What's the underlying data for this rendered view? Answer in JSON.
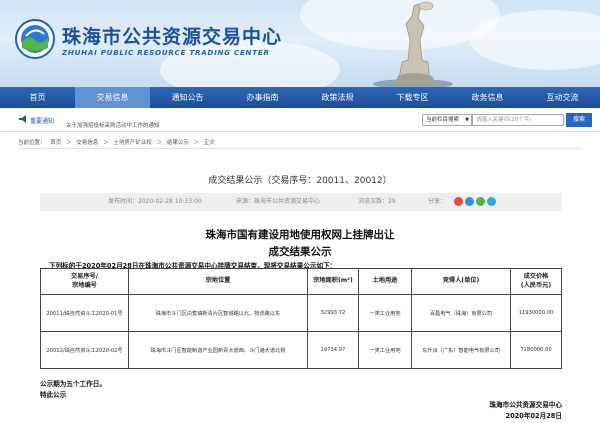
{
  "site": {
    "title": "珠海市公共资源交易中心",
    "subtitle": "ZHUHAI PUBLIC RESOURCE TRADING CENTER"
  },
  "nav": {
    "items": [
      {
        "label": "首页",
        "active": false
      },
      {
        "label": "交易信息",
        "active": true
      },
      {
        "label": "通知公告",
        "active": false
      },
      {
        "label": "办事指南",
        "active": false
      },
      {
        "label": "政策法规",
        "active": false
      },
      {
        "label": "下载专区",
        "active": false
      },
      {
        "label": "政务信息",
        "active": false
      },
      {
        "label": "互动交流",
        "active": false
      }
    ]
  },
  "notice": {
    "label": "重要通知",
    "text": "关于加强招投标采购活动中工作的通知"
  },
  "search": {
    "scope": "当前栏目搜索",
    "placeholder": "请输入关键词(20个字)",
    "button": "搜索"
  },
  "breadcrumb": [
    "当前位置：",
    "首页",
    "＞",
    "交易信息",
    "＞",
    "土地房产矿业权",
    "＞",
    "结果公示",
    "＞",
    "正文"
  ],
  "article": {
    "title": "成交结果公示（交易序号：20011、20012）",
    "meta": {
      "date": "发布时间：2020-02-28 10:33:00",
      "source": "来源：珠海市公共资源交易中心",
      "views": "浏览次数：29",
      "share_label": "分享："
    },
    "heading_line1": "珠海市国有建设用地使用权网上挂牌出让",
    "heading_line2": "成交结果公示",
    "intro": "下列标的于2020年02月28日在珠海市公共资源交易中心挂牌交易结束，现将交易结果公示如下："
  },
  "table": {
    "headers": [
      "交易序号/\n宗地编号",
      "宗地位置",
      "宗地面积(m²)",
      "土地用途",
      "竞得人(单位)",
      "成交价格\n(人民币元)"
    ],
    "rows": [
      [
        "20011/珠自然资斗工2020-01号",
        "珠海市斗门区白蕉镇新青片区智城路以北、物流路以东",
        "32993.72",
        "一类工业用地",
        "百昌电气（珠海）有限公司",
        "11930000.00"
      ],
      [
        "20012/珠自然资斗工2020-02号",
        "珠海市斗门区智能制造产业园新青大道西、斗门港大道北侧",
        "19734.97",
        "一类工业用地",
        "东升派（广东）智能电气有限公司",
        "7180000.00"
      ]
    ]
  },
  "footer": {
    "note_line1": "公示期为五个工作日。",
    "note_line2": "特此公示",
    "org": "珠海市公共资源交易中心",
    "date": "2020年02月28日"
  },
  "colors": {
    "brand_blue": "#1c4f9c",
    "nav_bg": "#1b4f9a",
    "nav_active": "#5f93d6",
    "search_button": "#2468c4"
  }
}
